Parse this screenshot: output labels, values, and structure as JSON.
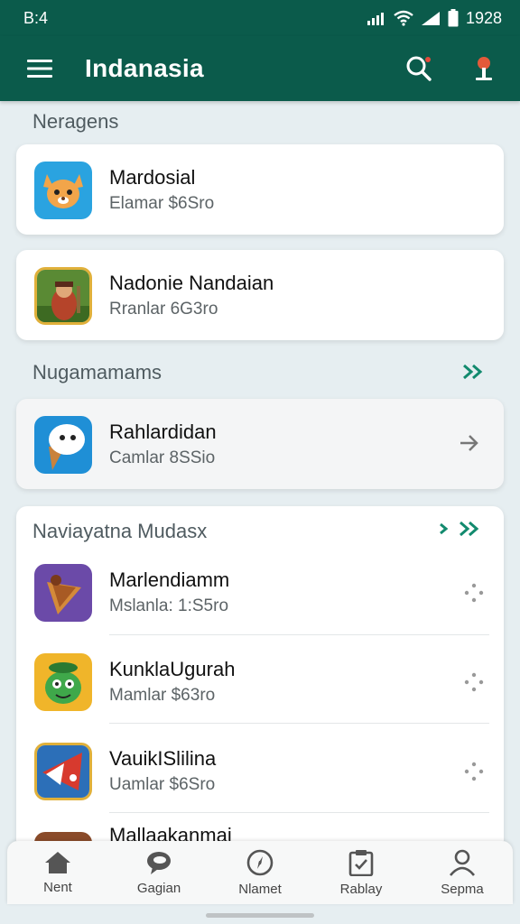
{
  "status": {
    "time": "B:4",
    "right_time": "1928"
  },
  "appbar": {
    "title": "Indanasia"
  },
  "sections": {
    "first": {
      "title": "Neragens"
    },
    "second": {
      "title": "Nugamamams"
    },
    "third": {
      "title": "Naviayatna Mudasx"
    }
  },
  "apps": [
    {
      "name": "Mardosial",
      "sub": "Elamar $6Sro",
      "icon": "fox-character-icon",
      "colors": [
        "#2aa3e0",
        "#f2a54a"
      ]
    },
    {
      "name": "Nadonie Nandaian",
      "sub": "Rranlar 6G3ro",
      "icon": "warrior-character-icon",
      "colors": [
        "#5a8a34",
        "#b5442a"
      ]
    },
    {
      "name": "Rahlardidan",
      "sub": "Camlar 8SSio",
      "icon": "ice-cream-cone-icon",
      "colors": [
        "#1f8fd6",
        "#c9823c"
      ]
    },
    {
      "name": "Marlendiamm",
      "sub": "Mslanla: 1:S5ro",
      "icon": "cone-shell-icon",
      "colors": [
        "#6b4aa8",
        "#d48a3a"
      ]
    },
    {
      "name": "KunklaUgurah",
      "sub": "Mamlar $63ro",
      "icon": "green-creature-icon",
      "colors": [
        "#f0b52a",
        "#3fa84a"
      ]
    },
    {
      "name": "VauikISlilina",
      "sub": "Uamlar $6Sro",
      "icon": "red-hat-icon",
      "colors": [
        "#2c6fb8",
        "#d73a2e"
      ]
    },
    {
      "name": "Mallaakanmai",
      "sub": "",
      "icon": "partial-app-icon",
      "colors": [
        "#8a4b2a",
        "#e0a040"
      ]
    }
  ],
  "bottomnav": [
    {
      "label": "Nent",
      "icon": "home-icon"
    },
    {
      "label": "Gagian",
      "icon": "chat-bubble-icon"
    },
    {
      "label": "Nlamet",
      "icon": "compass-icon"
    },
    {
      "label": "Rablay",
      "icon": "clipboard-icon"
    },
    {
      "label": "Sepma",
      "icon": "person-icon"
    }
  ],
  "colors": {
    "primary": "#0b5b4b",
    "accent": "#128a6e",
    "background": "#e6eef1"
  }
}
